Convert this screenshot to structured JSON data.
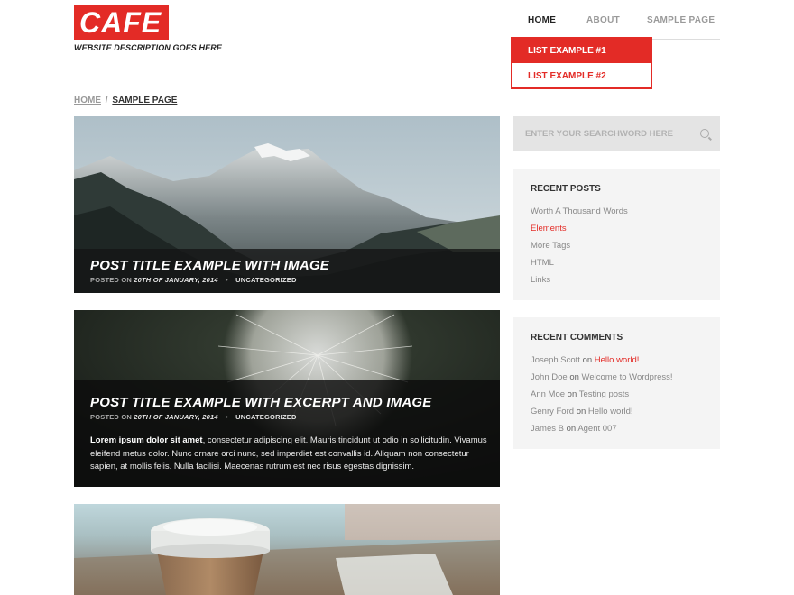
{
  "header": {
    "logo": "CAFE",
    "tagline": "WEBSITE DESCRIPTION GOES HERE"
  },
  "nav": {
    "items": [
      "HOME",
      "ABOUT",
      "SAMPLE PAGE"
    ],
    "dropdown": [
      "LIST EXAMPLE #1",
      "LIST EXAMPLE #2"
    ]
  },
  "breadcrumb": {
    "home": "HOME",
    "separator": "/",
    "current": "SAMPLE PAGE"
  },
  "posts": [
    {
      "title": "POST TITLE EXAMPLE WITH IMAGE",
      "meta_prefix": "POSTED ON",
      "date": "20TH OF JANUARY, 2014",
      "category": "UNCATEGORIZED"
    },
    {
      "title": "POST TITLE EXAMPLE WITH EXCERPT AND IMAGE",
      "meta_prefix": "POSTED ON",
      "date": "20TH OF JANUARY, 2014",
      "category": "UNCATEGORIZED",
      "excerpt_lead": "Lorem ipsum dolor sit amet",
      "excerpt_rest": ", consectetur adipiscing elit. Mauris tincidunt ut odio in sollicitudin. Vivamus eleifend metus dolor. Nunc ornare orci nunc, sed imperdiet est convallis id. Aliquam non consectetur sapien, at mollis felis. Nulla facilisi. Maecenas rutrum est nec risus egestas dignissim."
    }
  ],
  "sidebar": {
    "search_placeholder": "ENTER YOUR SEARCHWORD HERE",
    "recent_posts": {
      "title": "RECENT POSTS",
      "items": [
        "Worth A Thousand Words",
        "Elements",
        "More Tags",
        "HTML",
        "Links"
      ]
    },
    "recent_comments": {
      "title": "RECENT COMMENTS",
      "items": [
        {
          "author": "Joseph Scott",
          "on": "on",
          "post": "Hello world!"
        },
        {
          "author": "John Doe",
          "on": "on",
          "post": "Welcome to Wordpress!"
        },
        {
          "author": "Ann Moe",
          "on": "on",
          "post": "Testing posts"
        },
        {
          "author": "Genry Ford",
          "on": "on",
          "post": "Hello world!"
        },
        {
          "author": "James B",
          "on": "on",
          "post": "Agent 007"
        }
      ]
    }
  },
  "colors": {
    "accent": "#e32b26",
    "widget_bg": "#f4f4f4",
    "search_bg": "#e4e4e4"
  }
}
